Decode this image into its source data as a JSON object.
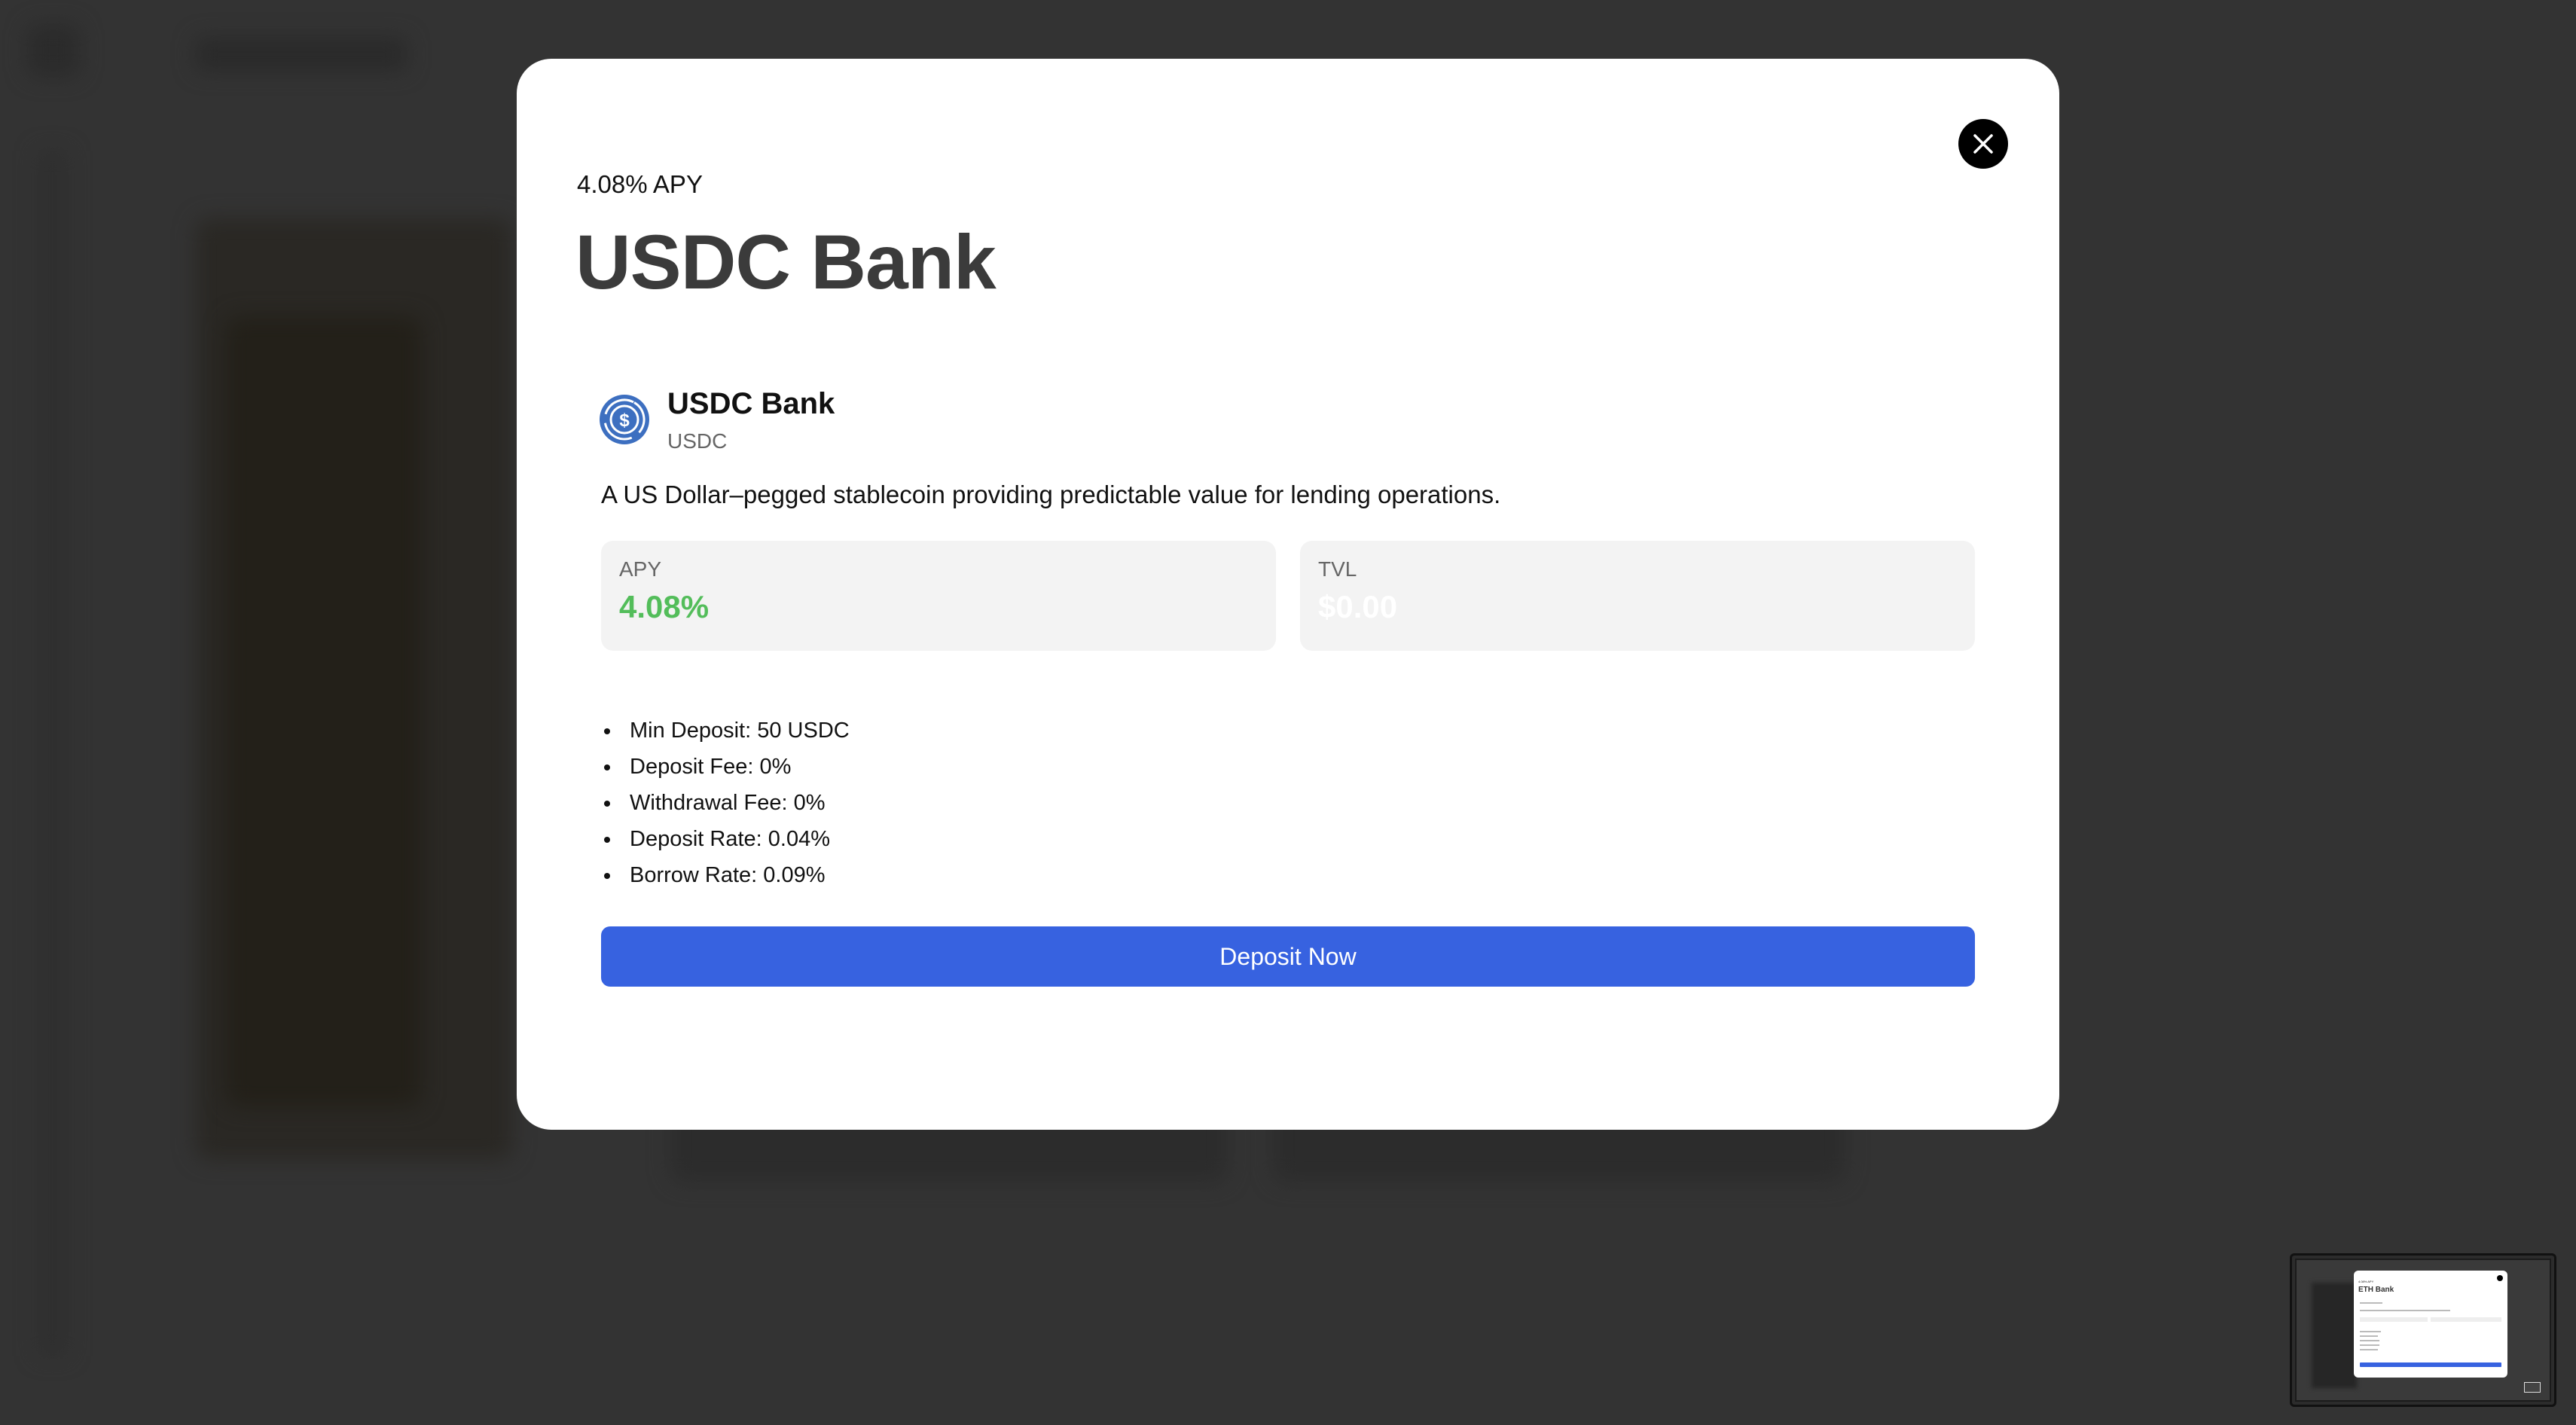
{
  "modal": {
    "apy_header": "4.08% APY",
    "title": "USDC Bank",
    "asset": {
      "name": "USDC Bank",
      "symbol": "USDC",
      "icon": "usdc-coin-icon",
      "description": "A US Dollar–pegged stablecoin providing predictable value for lending operations."
    },
    "stats": {
      "apy_label": "APY",
      "apy_value": "4.08%",
      "tvl_label": "TVL",
      "tvl_value": "$0.00"
    },
    "details": [
      "Min Deposit: 50 USDC",
      "Deposit Fee: 0%",
      "Withdrawal Fee: 0%",
      "Deposit Rate: 0.04%",
      "Borrow Rate: 0.09%"
    ],
    "deposit_button": "Deposit Now",
    "close_icon": "close-icon"
  },
  "thumbnail": {
    "apy_header": "4.08% APY",
    "title": "ETH Bank"
  },
  "colors": {
    "backdrop": "#333333",
    "accent": "#3762e0",
    "apy_green": "#53bd5a",
    "usdc_blue": "#2775ca"
  }
}
